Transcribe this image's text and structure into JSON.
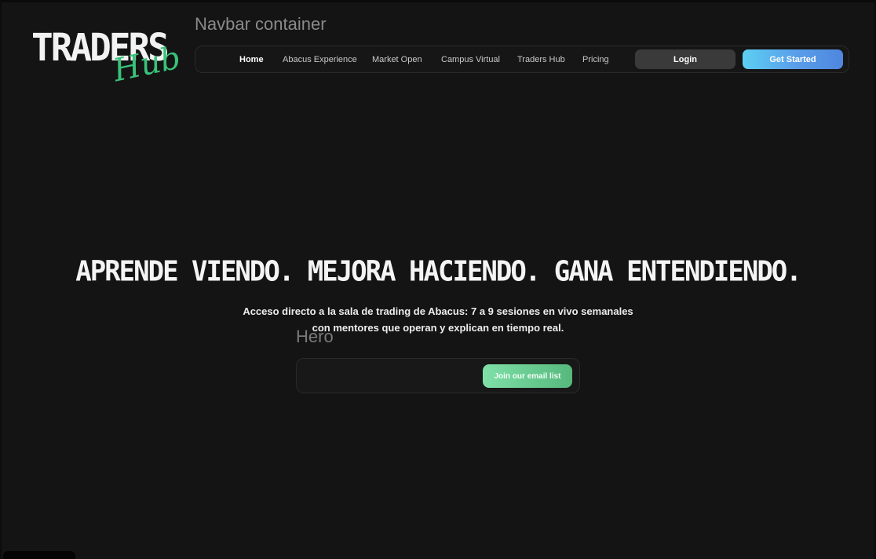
{
  "logo": {
    "main": "TRADERS",
    "script": "Hub"
  },
  "labels": {
    "navbar_container": "Navbar container",
    "hero": "Hero"
  },
  "nav": {
    "items": [
      {
        "label": "Home",
        "active": true
      },
      {
        "label": "Abacus Experience"
      },
      {
        "label": "Market Open"
      },
      {
        "label": "Campus Virtual"
      },
      {
        "label": "Traders Hub"
      },
      {
        "label": "Pricing"
      }
    ],
    "login_label": "Login",
    "get_started_label": "Get Started"
  },
  "hero": {
    "headline": "APRENDE VIENDO. MEJORA HACIENDO. GANA ENTENDIENDO.",
    "subtext": "Acceso directo a la sala de trading de Abacus: 7 a 9 sesiones en vivo semanales con mentores que operan y explican en tiempo real.",
    "email_placeholder": "",
    "join_label": "Join our email list"
  },
  "colors": {
    "background": "#141414",
    "accent_green": "#39c27a",
    "accent_blue": "#5aa0ea"
  }
}
